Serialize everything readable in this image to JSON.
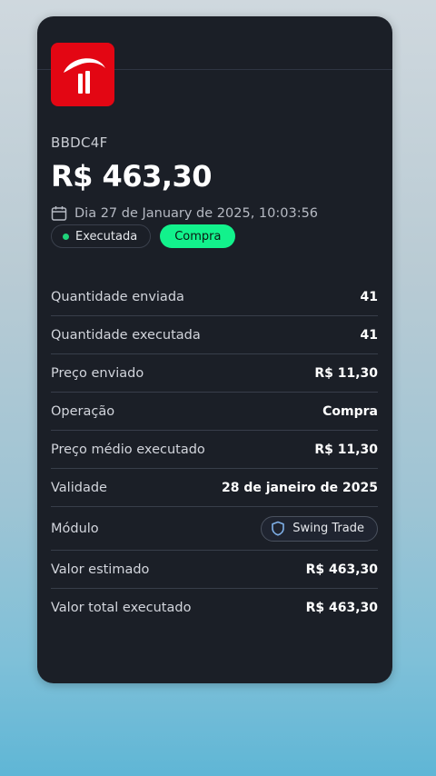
{
  "order": {
    "ticker": "BBDC4F",
    "amount": "R$ 463,30",
    "date": "Dia 27 de January de 2025, 10:03:56",
    "status_badge": "Executada",
    "side_badge": "Compra"
  },
  "details": [
    {
      "label": "Quantidade enviada",
      "value": "41"
    },
    {
      "label": "Quantidade executada",
      "value": "41"
    },
    {
      "label": "Preço enviado",
      "value": "R$ 11,30"
    },
    {
      "label": "Operação",
      "value": "Compra"
    },
    {
      "label": "Preço médio executado",
      "value": "R$ 11,30"
    },
    {
      "label": "Validade",
      "value": "28 de janeiro de 2025"
    },
    {
      "label": "Módulo",
      "value": "Swing Trade"
    },
    {
      "label": "Valor estimado",
      "value": "R$ 463,30"
    },
    {
      "label": "Valor total executado",
      "value": "R$ 463,30"
    }
  ],
  "colors": {
    "card_bg": "#1b1f27",
    "logo_red": "#e30613",
    "buy_green": "#12f28c",
    "status_dot": "#1fd37a"
  },
  "icons": {
    "logo": "bradesco-logo-icon",
    "date": "calendar-icon",
    "module": "shield-icon"
  }
}
